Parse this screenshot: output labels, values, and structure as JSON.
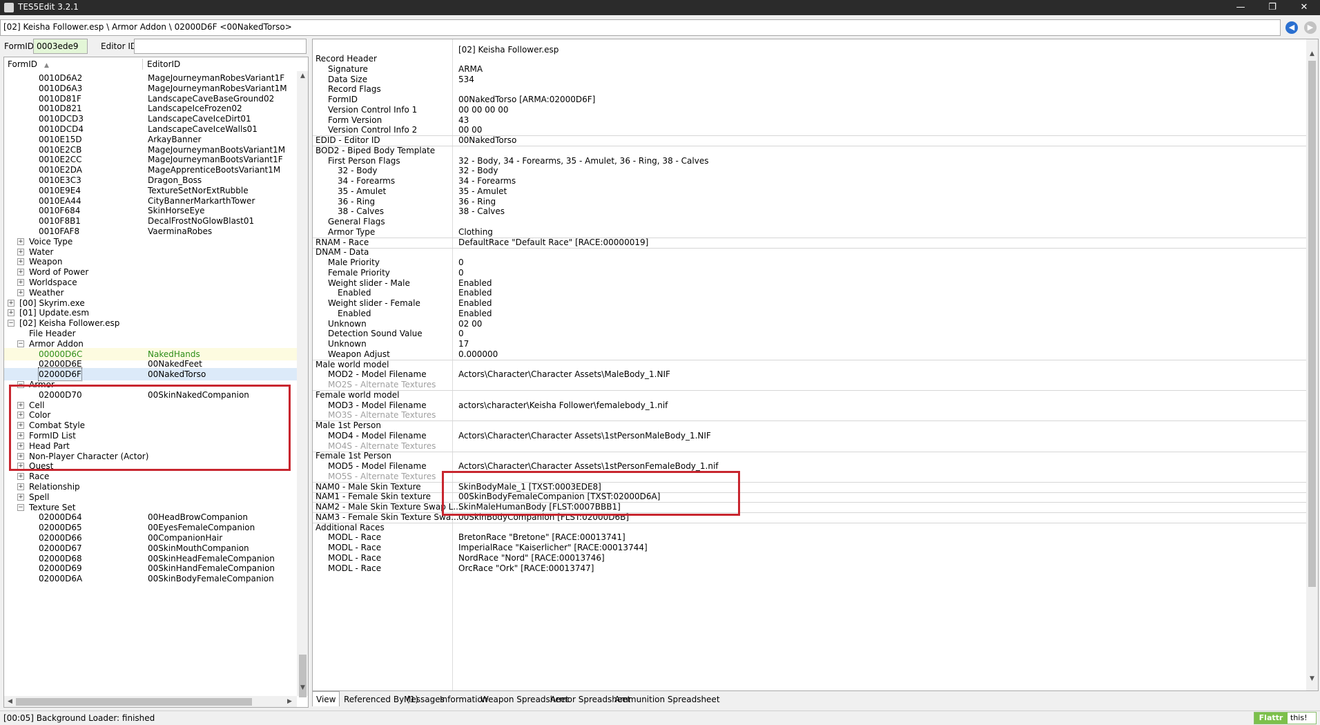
{
  "window": {
    "title": "TES5Edit 3.2.1"
  },
  "path": "[02] Keisha Follower.esp \\ Armor Addon \\ 02000D6F <00NakedTorso>",
  "filters": {
    "formid_label": "FormID",
    "formid_value": "0003ede9",
    "editorid_label": "Editor ID",
    "editorid_value": ""
  },
  "tree": {
    "col1": "FormID",
    "col2": "EditorID",
    "rows": [
      {
        "c1": "0010D6A2",
        "c2": "MageJourneymanRobesVariant1F"
      },
      {
        "c1": "0010D6A3",
        "c2": "MageJourneymanRobesVariant1M"
      },
      {
        "c1": "0010D81F",
        "c2": "LandscapeCaveBaseGround02"
      },
      {
        "c1": "0010D821",
        "c2": "LandscapeIceFrozen02"
      },
      {
        "c1": "0010DCD3",
        "c2": "LandscapeCaveIceDirt01"
      },
      {
        "c1": "0010DCD4",
        "c2": "LandscapeCaveIceWalls01"
      },
      {
        "c1": "0010E15D",
        "c2": "ArkayBanner"
      },
      {
        "c1": "0010E2CB",
        "c2": "MageJourneymanBootsVariant1M"
      },
      {
        "c1": "0010E2CC",
        "c2": "MageJourneymanBootsVariant1F"
      },
      {
        "c1": "0010E2DA",
        "c2": "MageApprenticeBootsVariant1M"
      },
      {
        "c1": "0010E3C3",
        "c2": "Dragon_Boss"
      },
      {
        "c1": "0010E9E4",
        "c2": "TextureSetNorExtRubble"
      },
      {
        "c1": "0010EA44",
        "c2": "CityBannerMarkarthTower"
      },
      {
        "c1": "0010F684",
        "c2": "SkinHorseEye"
      },
      {
        "c1": "0010F8B1",
        "c2": "DecalFrostNoGlowBlast01"
      },
      {
        "c1": "0010FAF8",
        "c2": "VaerminaRobes"
      },
      {
        "c1": "Voice Type",
        "c2": ""
      },
      {
        "c1": "Water",
        "c2": ""
      },
      {
        "c1": "Weapon",
        "c2": ""
      },
      {
        "c1": "Word of Power",
        "c2": ""
      },
      {
        "c1": "Worldspace",
        "c2": ""
      },
      {
        "c1": "Weather",
        "c2": ""
      },
      {
        "c1": "[00] Skyrim.exe",
        "c2": ""
      },
      {
        "c1": "[01] Update.esm",
        "c2": ""
      },
      {
        "c1": "[02] Keisha Follower.esp",
        "c2": ""
      },
      {
        "c1": "File Header",
        "c2": ""
      },
      {
        "c1": "Armor Addon",
        "c2": ""
      },
      {
        "c1": "00000D6C",
        "c2": "NakedHands"
      },
      {
        "c1": "02000D6E",
        "c2": "00NakedFeet"
      },
      {
        "c1": "02000D6F",
        "c2": "00NakedTorso"
      },
      {
        "c1": "Armor",
        "c2": ""
      },
      {
        "c1": "02000D70",
        "c2": "00SkinNakedCompanion"
      },
      {
        "c1": "Cell",
        "c2": ""
      },
      {
        "c1": "Color",
        "c2": ""
      },
      {
        "c1": "Combat Style",
        "c2": ""
      },
      {
        "c1": "FormID List",
        "c2": ""
      },
      {
        "c1": "Head Part",
        "c2": ""
      },
      {
        "c1": "Non-Player Character (Actor)",
        "c2": ""
      },
      {
        "c1": "Quest",
        "c2": ""
      },
      {
        "c1": "Race",
        "c2": ""
      },
      {
        "c1": "Relationship",
        "c2": ""
      },
      {
        "c1": "Spell",
        "c2": ""
      },
      {
        "c1": "Texture Set",
        "c2": ""
      },
      {
        "c1": "02000D64",
        "c2": "00HeadBrowCompanion"
      },
      {
        "c1": "02000D65",
        "c2": "00EyesFemaleCompanion"
      },
      {
        "c1": "02000D66",
        "c2": "00CompanionHair"
      },
      {
        "c1": "02000D67",
        "c2": "00SkinMouthCompanion"
      },
      {
        "c1": "02000D68",
        "c2": "00SkinHeadFemaleCompanion"
      },
      {
        "c1": "02000D69",
        "c2": "00SkinHandFemaleCompanion"
      },
      {
        "c1": "02000D6A",
        "c2": "00SkinBodyFemaleCompanion"
      }
    ]
  },
  "record": {
    "file_header": "[02] Keisha Follower.esp",
    "rows": [
      {
        "label": "Record Header",
        "value": ""
      },
      {
        "label": "Signature",
        "value": "ARMA"
      },
      {
        "label": "Data Size",
        "value": "534"
      },
      {
        "label": "Record Flags",
        "value": ""
      },
      {
        "label": "FormID",
        "value": "00NakedTorso [ARMA:02000D6F]"
      },
      {
        "label": "Version Control Info 1",
        "value": "00 00 00 00"
      },
      {
        "label": "Form Version",
        "value": "43"
      },
      {
        "label": "Version Control Info 2",
        "value": "00 00"
      },
      {
        "label": "EDID - Editor ID",
        "value": "00NakedTorso"
      },
      {
        "label": "BOD2 - Biped Body Template",
        "value": ""
      },
      {
        "label": "First Person Flags",
        "value": "32 - Body, 34 - Forearms, 35 - Amulet, 36 - Ring, 38 - Calves"
      },
      {
        "label": "32 - Body",
        "value": "32 - Body"
      },
      {
        "label": "34 - Forearms",
        "value": "34 - Forearms"
      },
      {
        "label": "35 - Amulet",
        "value": "35 - Amulet"
      },
      {
        "label": "36 - Ring",
        "value": "36 - Ring"
      },
      {
        "label": "38 - Calves",
        "value": "38 - Calves"
      },
      {
        "label": "General Flags",
        "value": ""
      },
      {
        "label": "Armor Type",
        "value": "Clothing"
      },
      {
        "label": "RNAM - Race",
        "value": "DefaultRace \"Default Race\" [RACE:00000019]"
      },
      {
        "label": "DNAM - Data",
        "value": ""
      },
      {
        "label": "Male Priority",
        "value": "0"
      },
      {
        "label": "Female Priority",
        "value": "0"
      },
      {
        "label": "Weight slider - Male",
        "value": "Enabled"
      },
      {
        "label": "Enabled",
        "value": "Enabled"
      },
      {
        "label": "Weight slider - Female",
        "value": "Enabled"
      },
      {
        "label": "Enabled",
        "value": "Enabled"
      },
      {
        "label": "Unknown",
        "value": "02 00"
      },
      {
        "label": "Detection Sound Value",
        "value": "0"
      },
      {
        "label": "Unknown",
        "value": "17"
      },
      {
        "label": "Weapon Adjust",
        "value": "0.000000"
      },
      {
        "label": "Male world model",
        "value": ""
      },
      {
        "label": "MOD2 - Model Filename",
        "value": "Actors\\Character\\Character Assets\\MaleBody_1.NIF"
      },
      {
        "label": "MO2S - Alternate Textures",
        "value": ""
      },
      {
        "label": "Female world model",
        "value": ""
      },
      {
        "label": "MOD3 - Model Filename",
        "value": "actors\\character\\Keisha Follower\\femalebody_1.nif"
      },
      {
        "label": "MO3S - Alternate Textures",
        "value": ""
      },
      {
        "label": "Male 1st Person",
        "value": ""
      },
      {
        "label": "MOD4 - Model Filename",
        "value": "Actors\\Character\\Character Assets\\1stPersonMaleBody_1.NIF"
      },
      {
        "label": "MO4S - Alternate Textures",
        "value": ""
      },
      {
        "label": "Female 1st Person",
        "value": ""
      },
      {
        "label": "MOD5 - Model Filename",
        "value": "Actors\\Character\\Character Assets\\1stPersonFemaleBody_1.nif"
      },
      {
        "label": "MO5S - Alternate Textures",
        "value": ""
      },
      {
        "label": "NAM0 - Male Skin Texture",
        "value": "SkinBodyMale_1 [TXST:0003EDE8]"
      },
      {
        "label": "NAM1 - Female Skin texture",
        "value": "00SkinBodyFemaleCompanion [TXST:02000D6A]"
      },
      {
        "label": "NAM2 - Male Skin Texture Swap L...",
        "value": "SkinMaleHumanBody [FLST:0007BBB1]"
      },
      {
        "label": "NAM3 - Female Skin Texture Swa...",
        "value": "00SkinBodyCompanion [FLST:02000D6B]"
      },
      {
        "label": "Additional Races",
        "value": ""
      },
      {
        "label": "MODL - Race",
        "value": "BretonRace \"Bretone\" [RACE:00013741]"
      },
      {
        "label": "MODL - Race",
        "value": "ImperialRace \"Kaiserlicher\" [RACE:00013744]"
      },
      {
        "label": "MODL - Race",
        "value": "NordRace \"Nord\" [RACE:00013746]"
      },
      {
        "label": "MODL - Race",
        "value": "OrcRace \"Ork\" [RACE:00013747]"
      }
    ]
  },
  "tabs": [
    "View",
    "Referenced By (1)",
    "Messages",
    "Information",
    "Weapon Spreadsheet",
    "Armor Spreadsheet",
    "Ammunition Spreadsheet"
  ],
  "status": "[00:05] Background Loader: finished",
  "flattr": {
    "left": "Flattr",
    "right": "this!"
  },
  "colors": {
    "highlight_box": "#c8262f",
    "selected_row": "#dceaf9",
    "formid_bg": "#e3f6d7"
  }
}
